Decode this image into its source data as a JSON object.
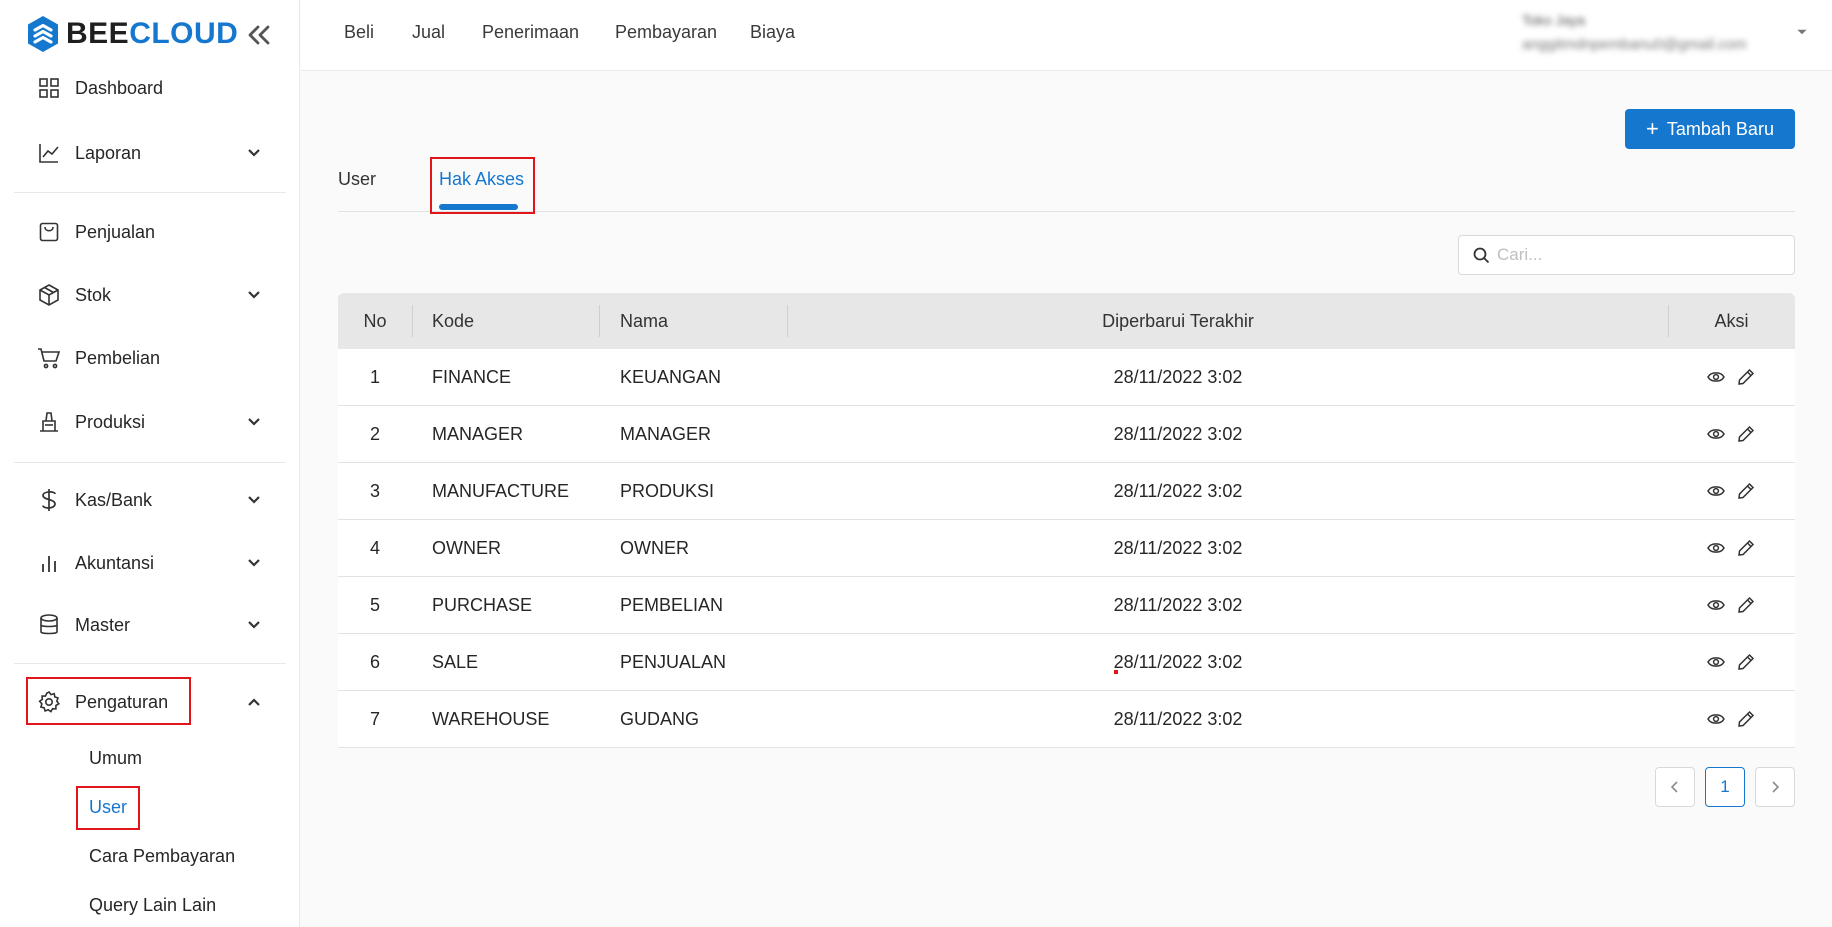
{
  "brand": {
    "part1": "BEE",
    "part2": "CLOUD"
  },
  "sidebar": {
    "items": [
      {
        "label": "Dashboard",
        "icon": "grid-icon"
      },
      {
        "label": "Laporan",
        "icon": "chart-line-icon"
      },
      {
        "label": "Penjualan",
        "icon": "bag-icon"
      },
      {
        "label": "Stok",
        "icon": "box-icon"
      },
      {
        "label": "Pembelian",
        "icon": "cart-icon"
      },
      {
        "label": "Produksi",
        "icon": "factory-icon"
      },
      {
        "label": "Kas/Bank",
        "icon": "dollar-icon"
      },
      {
        "label": "Akuntansi",
        "icon": "bar-chart-icon"
      },
      {
        "label": "Master",
        "icon": "database-icon"
      },
      {
        "label": "Pengaturan",
        "icon": "gear-icon"
      }
    ],
    "sub_items": [
      {
        "label": "Umum"
      },
      {
        "label": "User"
      },
      {
        "label": "Cara Pembayaran"
      },
      {
        "label": "Query Lain Lain"
      }
    ]
  },
  "topnav": {
    "items": [
      "Beli",
      "Jual",
      "Penerimaan",
      "Pembayaran",
      "Biaya"
    ]
  },
  "user": {
    "name": "Toko Jaya",
    "email": "anggitmdnpembanu0@gmail.com"
  },
  "toolbar": {
    "add_label": "Tambah Baru"
  },
  "tabs": [
    {
      "label": "User"
    },
    {
      "label": "Hak Akses"
    }
  ],
  "search": {
    "placeholder": "Cari..."
  },
  "table": {
    "headers": [
      "No",
      "Kode",
      "Nama",
      "Diperbarui Terakhir",
      "Aksi"
    ],
    "rows": [
      {
        "no": "1",
        "kode": "FINANCE",
        "nama": "KEUANGAN",
        "updated": "28/11/2022 3:02"
      },
      {
        "no": "2",
        "kode": "MANAGER",
        "nama": "MANAGER",
        "updated": "28/11/2022 3:02"
      },
      {
        "no": "3",
        "kode": "MANUFACTURE",
        "nama": "PRODUKSI",
        "updated": "28/11/2022 3:02"
      },
      {
        "no": "4",
        "kode": "OWNER",
        "nama": "OWNER",
        "updated": "28/11/2022 3:02"
      },
      {
        "no": "5",
        "kode": "PURCHASE",
        "nama": "PEMBELIAN",
        "updated": "28/11/2022 3:02"
      },
      {
        "no": "6",
        "kode": "SALE",
        "nama": "PENJUALAN",
        "updated": "28/11/2022 3:02"
      },
      {
        "no": "7",
        "kode": "WAREHOUSE",
        "nama": "GUDANG",
        "updated": "28/11/2022 3:02"
      }
    ]
  },
  "pagination": {
    "current": "1",
    "prev_icon": "chevron-left-icon",
    "next_icon": "chevron-right-icon"
  },
  "colors": {
    "accent": "#1677cf",
    "highlight": "#e0161b"
  }
}
